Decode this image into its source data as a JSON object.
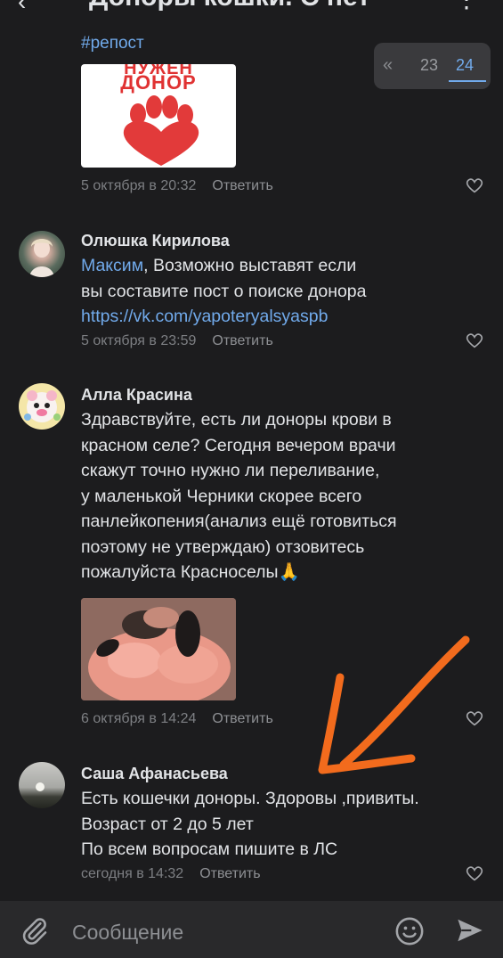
{
  "header": {
    "back_icon": "‹",
    "title": "Доноры кошки. С пет",
    "more_icon": "⋮"
  },
  "pagination": {
    "first_icon": "«",
    "pages": [
      "23",
      "24"
    ],
    "current": "24"
  },
  "posts": [
    {
      "text": "#репост",
      "image": {
        "top_text": "НУЖЕН",
        "main_text": "ДОНОР"
      },
      "date": "5 октября в 20:32",
      "reply": "Ответить"
    }
  ],
  "comments": [
    {
      "author": "Олюшка Кирилова",
      "mention": "Максим",
      "lines": [
        ", Возможно выставят  если",
        "вы составите пост о поиске донора"
      ],
      "link": "https://vk.com/yapoteryalsyaspb",
      "date": "5 октября в 23:59",
      "reply": "Ответить"
    },
    {
      "author": "Алла Красина",
      "lines": [
        "Здравствуйте, есть ли доноры крови в",
        "красном селе? Сегодня вечером врачи",
        "скажут точно нужно ли переливание,",
        "у маленькой Черники скорее всего",
        "панлейкопения(анализ ещё готовиться",
        "поэтому не утверждаю) отзовитесь",
        "пожалуйста Красноселы"
      ],
      "emoji": "🙏",
      "date": "6 октября в 14:24",
      "reply": "Ответить"
    },
    {
      "author": "Саша Афанасьева",
      "lines": [
        "Есть кошечки доноры. Здоровы ,привиты.",
        "Возраст от 2 до 5 лет",
        "По всем вопросам пишите в ЛС"
      ],
      "date": "сегодня в 14:32",
      "reply": "Ответить"
    }
  ],
  "composer": {
    "placeholder": "Сообщение",
    "attach_icon": "paperclip-icon",
    "emoji_icon": "smile-icon",
    "send_icon": "send-icon"
  },
  "colors": {
    "background": "#1c1c1e",
    "link": "#71aaeb",
    "meta": "#7d7f83",
    "annotation_arrow": "#f26b1d"
  }
}
